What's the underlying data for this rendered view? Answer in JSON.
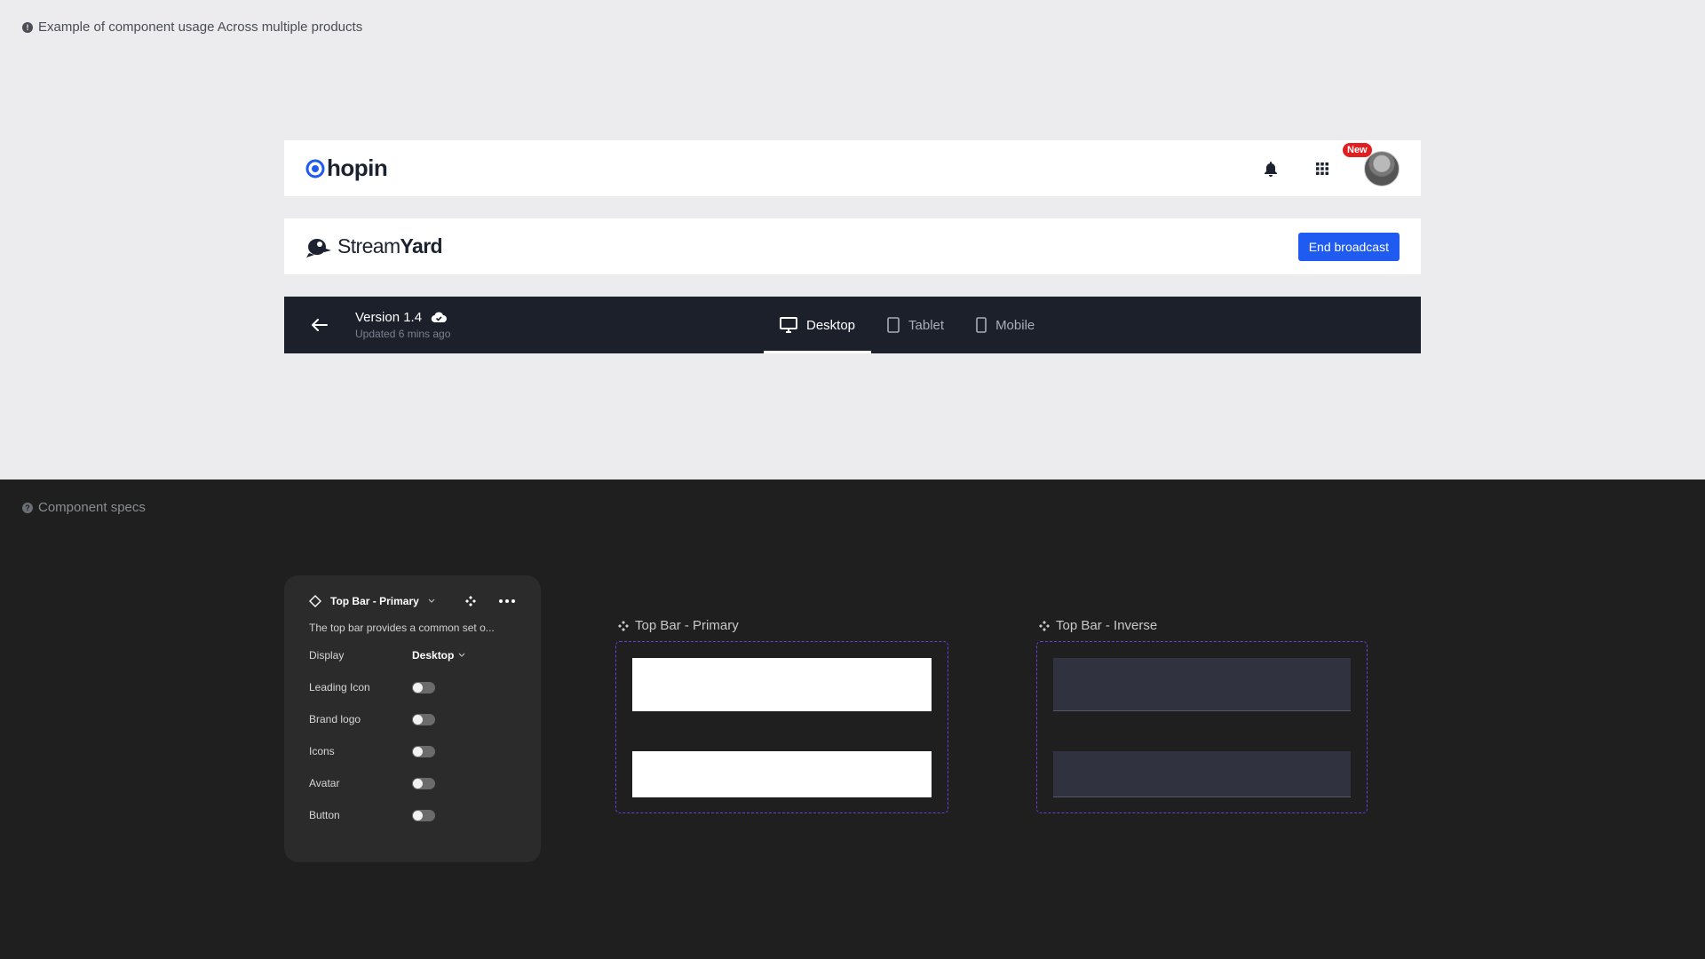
{
  "notes": {
    "top": "Example of component usage Across multiple products",
    "bottom": "Component specs"
  },
  "hopin_bar": {
    "logo_text": "hopin",
    "badge": "New",
    "brand_color": "#1f5bf0"
  },
  "streamyard_bar": {
    "logo_text_regular": "Stream",
    "logo_text_bold": "Yard",
    "button_label": "End broadcast",
    "button_color": "#1f5bf0"
  },
  "editor_bar": {
    "version": "Version 1.4",
    "updated": "Updated 6 mins ago",
    "tabs": [
      {
        "label": "Desktop",
        "icon": "monitor-icon",
        "active": true
      },
      {
        "label": "Tablet",
        "icon": "tablet-icon",
        "active": false
      },
      {
        "label": "Mobile",
        "icon": "mobile-icon",
        "active": false
      }
    ]
  },
  "panel": {
    "title": "Top Bar - Primary",
    "description": "The top bar provides a common set o...",
    "display_label": "Display",
    "display_value": "Desktop",
    "toggles": [
      {
        "label": "Leading Icon",
        "on": false
      },
      {
        "label": "Brand logo",
        "on": false
      },
      {
        "label": "Icons",
        "on": false
      },
      {
        "label": "Avatar",
        "on": false
      },
      {
        "label": "Button",
        "on": false
      }
    ]
  },
  "variants": {
    "primary": "Top Bar - Primary",
    "inverse": "Top Bar - Inverse"
  }
}
